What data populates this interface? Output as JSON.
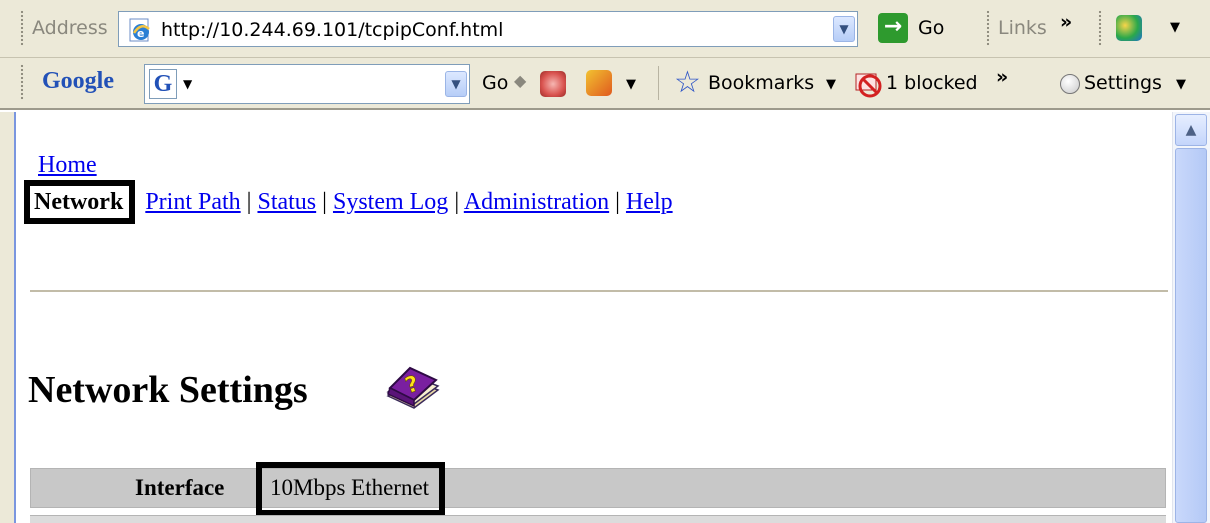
{
  "address_bar": {
    "label": "Address",
    "url": "http://10.244.69.101/tcpipConf.html",
    "go_label": "Go",
    "links_label": "Links",
    "chevron": "»"
  },
  "google_bar": {
    "brand": "Google",
    "go_label": "Go",
    "bookmarks_label": "Bookmarks",
    "blocked_label": "1 blocked",
    "chevron": "»",
    "settings_label": "Settings"
  },
  "nav": {
    "home": "Home",
    "network": "Network",
    "items": [
      "Print Path",
      "Status",
      "System Log",
      "Administration",
      "Help"
    ],
    "separator": "|"
  },
  "page": {
    "heading": "Network Settings",
    "interface_label": "Interface",
    "interface_value": "10Mbps Ethernet"
  },
  "icons": [
    "ie-page-icon",
    "go-arrow-icon",
    "google-g-icon",
    "bookmark-star-icon",
    "popup-blocker-icon",
    "settings-radio-icon",
    "help-book-icon",
    "scroll-up-arrow-icon"
  ],
  "colors": {
    "link": "#0000ee",
    "toolbar": "#ece9d8",
    "table_row": "#c8c8c8"
  }
}
